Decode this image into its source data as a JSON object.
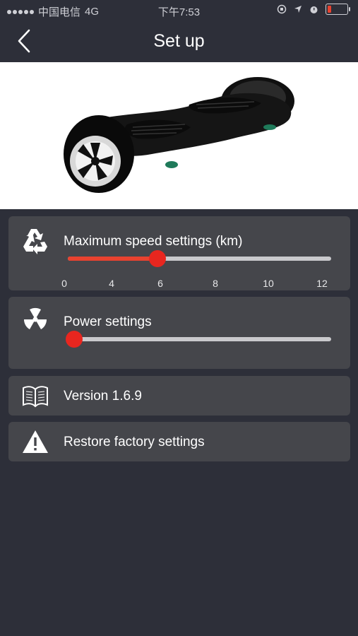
{
  "status_bar": {
    "carrier": "中国电信",
    "network": "4G",
    "time": "下午7:53"
  },
  "navbar": {
    "title": "Set up",
    "back_icon": "chevron-left-icon"
  },
  "hero": {
    "image": "hoverboard-image"
  },
  "speed_card": {
    "label": "Maximum speed settings (km)",
    "icon": "recycle-icon",
    "value": 6,
    "min": 0,
    "max": 12,
    "ticks": [
      "0",
      "4",
      "6",
      "8",
      "10",
      "12"
    ]
  },
  "power_card": {
    "label": "Power settings",
    "icon": "radiation-icon",
    "value": 0
  },
  "version_card": {
    "label": "Version 1.6.9",
    "icon": "book-icon"
  },
  "restore_card": {
    "label": "Restore factory settings",
    "icon": "warning-icon"
  },
  "colors": {
    "background": "#2d2f39",
    "card": "#45464b",
    "accent": "#e8422f"
  }
}
